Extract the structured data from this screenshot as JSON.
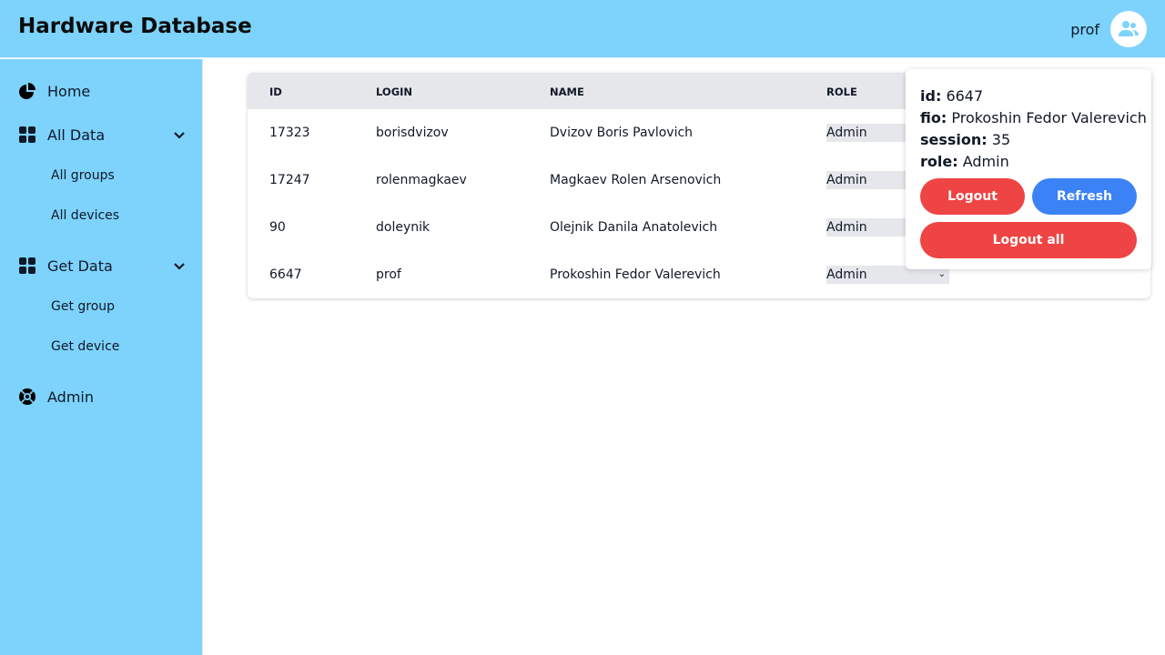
{
  "header": {
    "title": "Hardware Database",
    "username": "prof"
  },
  "sidebar": {
    "home": "Home",
    "all_data": {
      "label": "All Data",
      "items": [
        "All groups",
        "All devices"
      ]
    },
    "get_data": {
      "label": "Get Data",
      "items": [
        "Get group",
        "Get device"
      ]
    },
    "admin": "Admin"
  },
  "table": {
    "headers": [
      "ID",
      "LOGIN",
      "NAME",
      "ROLE"
    ],
    "rows": [
      {
        "id": "17323",
        "login": "borisdvizov",
        "name": "Dvizov Boris Pavlovich",
        "role": "Admin"
      },
      {
        "id": "17247",
        "login": "rolenmagkaev",
        "name": "Magkaev Rolen Arsenovich",
        "role": "Admin"
      },
      {
        "id": "90",
        "login": "doleynik",
        "name": "Olejnik Danila Anatolevich",
        "role": "Admin"
      },
      {
        "id": "6647",
        "login": "prof",
        "name": "Prokoshin Fedor Valerevich",
        "role": "Admin"
      }
    ]
  },
  "popup": {
    "id_label": "id:",
    "id": "6647",
    "fio_label": "fio:",
    "fio": "Prokoshin Fedor Valerevich",
    "session_label": "session:",
    "session": "35",
    "role_label": "role:",
    "role": "Admin",
    "logout": "Logout",
    "refresh": "Refresh",
    "logout_all": "Logout all"
  },
  "colors": {
    "primary": "#7dd3fc",
    "danger": "#ef4444",
    "accent": "#3b82f6"
  }
}
